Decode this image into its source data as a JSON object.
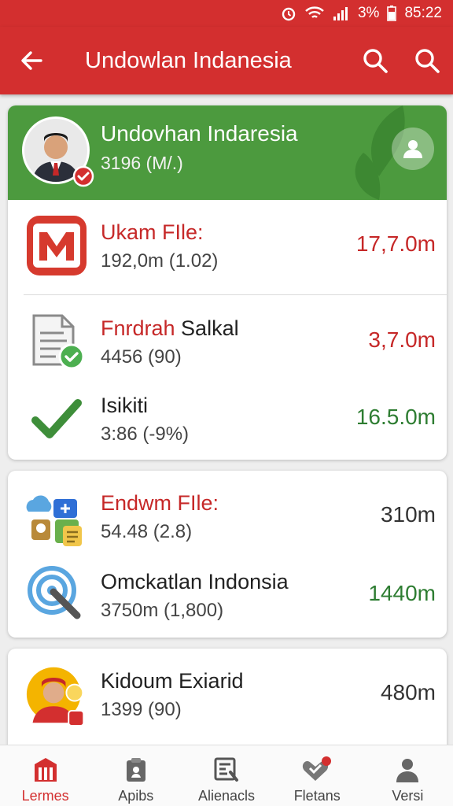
{
  "status_bar": {
    "percent": "3%",
    "time": "85:22"
  },
  "app_bar": {
    "title": "Undowlan Indanesia"
  },
  "profile": {
    "name": "Undovhan Indaresia",
    "count": "3196 (M/.)"
  },
  "card1_rows": [
    {
      "name_red": "Ukam FIle:",
      "name_black": "",
      "sub": "192,0m (1.02)",
      "value": "17,7.0m"
    },
    {
      "name_red": "Fnrdrah",
      "name_black": " Salkal",
      "sub": "4456 (90)",
      "value": "3,7.0m"
    },
    {
      "name_red": "",
      "name_black": "Isikiti",
      "sub": "3:86 (-9%)",
      "value": "16.5.0m"
    }
  ],
  "card2_rows": [
    {
      "name_red": "Endwm FIle:",
      "name_black": "",
      "sub": "54.48 (2.8)",
      "value": "310m"
    },
    {
      "name_red": "",
      "name_black": "Omckatlan Indonsia",
      "sub": "3750m (1,800)",
      "value": "1440m"
    }
  ],
  "card3_rows": [
    {
      "name_red": "",
      "name_black": "Kidoum Exiarid",
      "sub": "1399 (90)",
      "value": "480m"
    }
  ],
  "bottom_nav": [
    {
      "label": "Lermes",
      "icon": "building-icon",
      "active": true
    },
    {
      "label": "Apibs",
      "icon": "clipboard-icon",
      "active": false
    },
    {
      "label": "Alienacls",
      "icon": "document-chart-icon",
      "active": false
    },
    {
      "label": "Fletans",
      "icon": "heart-notification-icon",
      "active": false
    },
    {
      "label": "Versi",
      "icon": "person-icon",
      "active": false
    }
  ],
  "colors": {
    "primary_red": "#d32f2f",
    "profile_green": "#4c9a3e",
    "value_red": "#c62828",
    "value_green": "#2e7d32"
  }
}
